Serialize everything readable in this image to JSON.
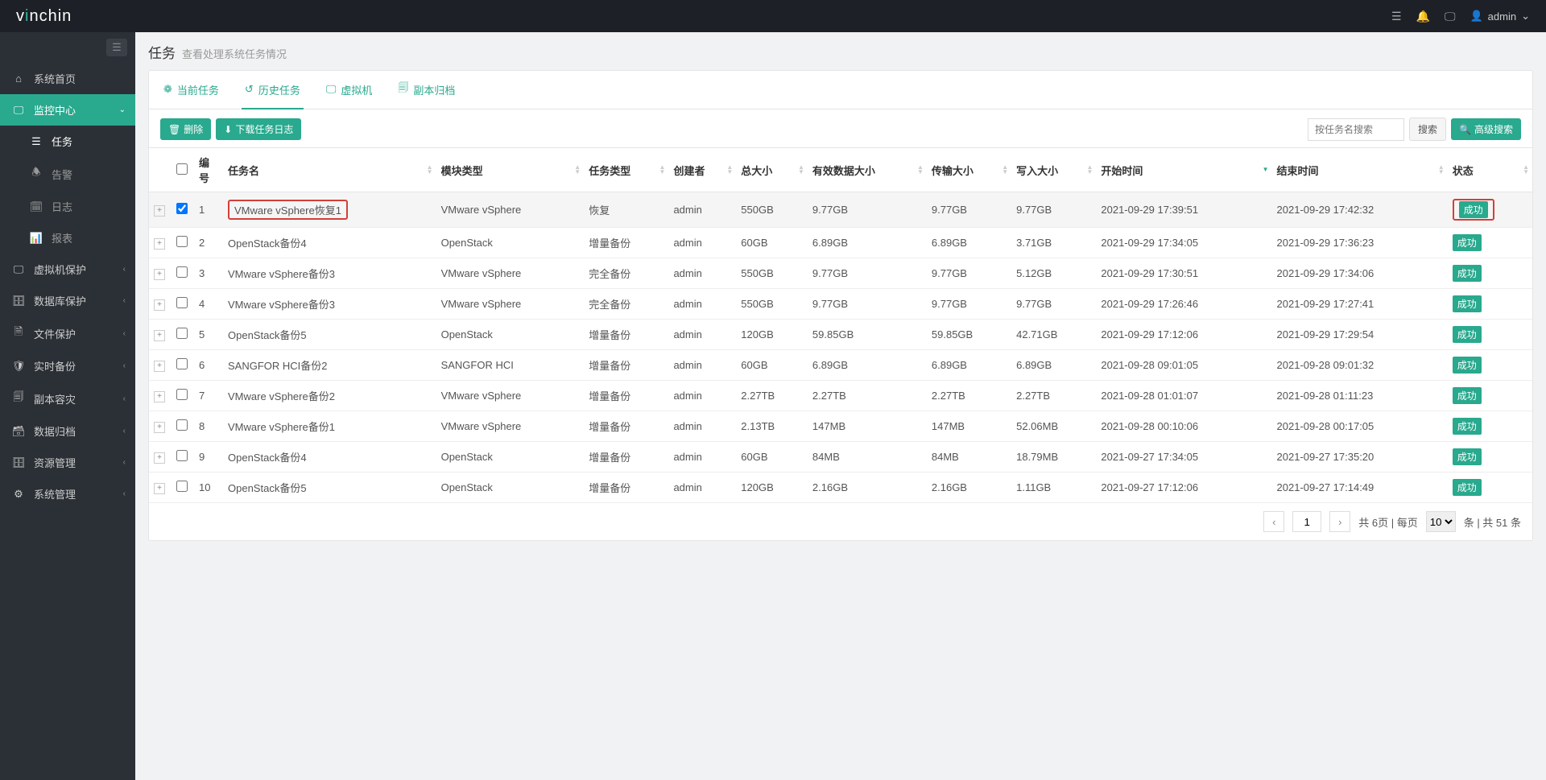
{
  "header": {
    "logo_prefix": "v",
    "logo_mid": "i",
    "logo_rest": "nchin",
    "user": "admin"
  },
  "sidebar": {
    "items": [
      {
        "label": "系统首页",
        "icon": "⌂"
      },
      {
        "label": "监控中心",
        "icon": "🖵",
        "active": true,
        "expanded": true
      },
      {
        "label": "虚拟机保护",
        "icon": "🖵"
      },
      {
        "label": "数据库保护",
        "icon": "🗄"
      },
      {
        "label": "文件保护",
        "icon": "🗎"
      },
      {
        "label": "实时备份",
        "icon": "🛡"
      },
      {
        "label": "副本容灾",
        "icon": "🗐"
      },
      {
        "label": "数据归档",
        "icon": "🗃"
      },
      {
        "label": "资源管理",
        "icon": "🗄"
      },
      {
        "label": "系统管理",
        "icon": "⚙"
      }
    ],
    "submenu": [
      {
        "label": "任务",
        "icon": "☰",
        "active": true
      },
      {
        "label": "告警",
        "icon": "🕭"
      },
      {
        "label": "日志",
        "icon": "🗓"
      },
      {
        "label": "报表",
        "icon": "📊"
      }
    ]
  },
  "page": {
    "title": "任务",
    "subtitle": "查看处理系统任务情况"
  },
  "tabs": [
    {
      "label": "当前任务",
      "icon": "❁"
    },
    {
      "label": "历史任务",
      "icon": "↺",
      "active": true
    },
    {
      "label": "虚拟机",
      "icon": "🖵"
    },
    {
      "label": "副本归档",
      "icon": "🗐"
    }
  ],
  "toolbar": {
    "delete": "删除",
    "download": "下载任务日志",
    "search_placeholder": "按任务名搜索",
    "search_btn": "搜索",
    "adv_search": "高级搜索"
  },
  "columns": {
    "num": "编号",
    "name": "任务名",
    "module": "模块类型",
    "type": "任务类型",
    "creator": "创建者",
    "total": "总大小",
    "valid": "有效数据大小",
    "transfer": "传输大小",
    "written": "写入大小",
    "start": "开始时间",
    "end": "结束时间",
    "status": "状态"
  },
  "rows": [
    {
      "num": "1",
      "name": "VMware vSphere恢复1",
      "module": "VMware vSphere",
      "type": "恢复",
      "creator": "admin",
      "total": "550GB",
      "valid": "9.77GB",
      "transfer": "9.77GB",
      "written": "9.77GB",
      "start": "2021-09-29 17:39:51",
      "end": "2021-09-29 17:42:32",
      "status": "成功",
      "selected": true,
      "hl_name": true,
      "hl_status": true
    },
    {
      "num": "2",
      "name": "OpenStack备份4",
      "module": "OpenStack",
      "type": "增量备份",
      "creator": "admin",
      "total": "60GB",
      "valid": "6.89GB",
      "transfer": "6.89GB",
      "written": "3.71GB",
      "start": "2021-09-29 17:34:05",
      "end": "2021-09-29 17:36:23",
      "status": "成功"
    },
    {
      "num": "3",
      "name": "VMware vSphere备份3",
      "module": "VMware vSphere",
      "type": "完全备份",
      "creator": "admin",
      "total": "550GB",
      "valid": "9.77GB",
      "transfer": "9.77GB",
      "written": "5.12GB",
      "start": "2021-09-29 17:30:51",
      "end": "2021-09-29 17:34:06",
      "status": "成功"
    },
    {
      "num": "4",
      "name": "VMware vSphere备份3",
      "module": "VMware vSphere",
      "type": "完全备份",
      "creator": "admin",
      "total": "550GB",
      "valid": "9.77GB",
      "transfer": "9.77GB",
      "written": "9.77GB",
      "start": "2021-09-29 17:26:46",
      "end": "2021-09-29 17:27:41",
      "status": "成功"
    },
    {
      "num": "5",
      "name": "OpenStack备份5",
      "module": "OpenStack",
      "type": "增量备份",
      "creator": "admin",
      "total": "120GB",
      "valid": "59.85GB",
      "transfer": "59.85GB",
      "written": "42.71GB",
      "start": "2021-09-29 17:12:06",
      "end": "2021-09-29 17:29:54",
      "status": "成功"
    },
    {
      "num": "6",
      "name": "SANGFOR HCI备份2",
      "module": "SANGFOR HCI",
      "type": "增量备份",
      "creator": "admin",
      "total": "60GB",
      "valid": "6.89GB",
      "transfer": "6.89GB",
      "written": "6.89GB",
      "start": "2021-09-28 09:01:05",
      "end": "2021-09-28 09:01:32",
      "status": "成功"
    },
    {
      "num": "7",
      "name": "VMware vSphere备份2",
      "module": "VMware vSphere",
      "type": "增量备份",
      "creator": "admin",
      "total": "2.27TB",
      "valid": "2.27TB",
      "transfer": "2.27TB",
      "written": "2.27TB",
      "start": "2021-09-28 01:01:07",
      "end": "2021-09-28 01:11:23",
      "status": "成功"
    },
    {
      "num": "8",
      "name": "VMware vSphere备份1",
      "module": "VMware vSphere",
      "type": "增量备份",
      "creator": "admin",
      "total": "2.13TB",
      "valid": "147MB",
      "transfer": "147MB",
      "written": "52.06MB",
      "start": "2021-09-28 00:10:06",
      "end": "2021-09-28 00:17:05",
      "status": "成功"
    },
    {
      "num": "9",
      "name": "OpenStack备份4",
      "module": "OpenStack",
      "type": "增量备份",
      "creator": "admin",
      "total": "60GB",
      "valid": "84MB",
      "transfer": "84MB",
      "written": "18.79MB",
      "start": "2021-09-27 17:34:05",
      "end": "2021-09-27 17:35:20",
      "status": "成功"
    },
    {
      "num": "10",
      "name": "OpenStack备份5",
      "module": "OpenStack",
      "type": "增量备份",
      "creator": "admin",
      "total": "120GB",
      "valid": "2.16GB",
      "transfer": "2.16GB",
      "written": "1.11GB",
      "start": "2021-09-27 17:12:06",
      "end": "2021-09-27 17:14:49",
      "status": "成功"
    }
  ],
  "pagination": {
    "current": "1",
    "total_pages_text": "共 6页 | 每页",
    "per_page": "10",
    "total_text": "条 | 共 51 条"
  }
}
